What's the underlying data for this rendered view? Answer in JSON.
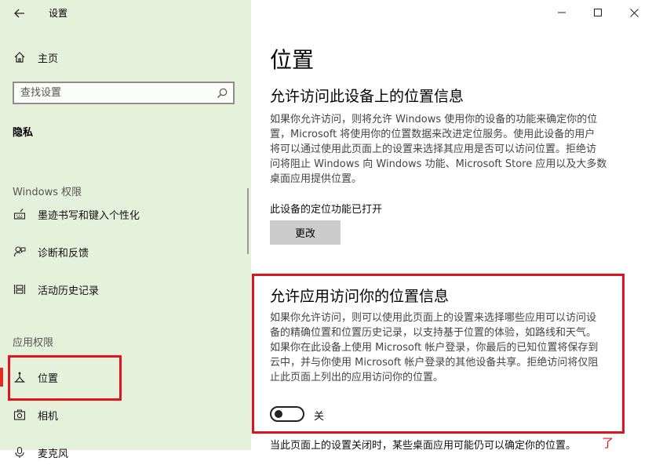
{
  "window": {
    "title": "设置",
    "controls": [
      "minimize",
      "maximize",
      "close"
    ]
  },
  "sidebar": {
    "home_label": "主页",
    "search_placeholder": "查找设置",
    "privacy_heading": "隐私",
    "windows_group": "Windows 权限",
    "windows_items": [
      {
        "label": "墨迹书写和键入个性化",
        "icon": "keyboard-pen-icon"
      },
      {
        "label": "诊断和反馈",
        "icon": "feedback-icon"
      },
      {
        "label": "活动历史记录",
        "icon": "activity-history-icon"
      }
    ],
    "app_group": "应用权限",
    "app_items": [
      {
        "label": "位置",
        "icon": "location-icon",
        "selected": true
      },
      {
        "label": "相机",
        "icon": "camera-icon"
      },
      {
        "label": "麦克风",
        "icon": "microphone-icon"
      }
    ]
  },
  "main": {
    "title": "位置",
    "section1": {
      "title": "允许访问此设备上的位置信息",
      "lines": [
        "如果你允许访问，则将允许 Windows 使用你的设备的功能来确定你的位",
        "置，Microsoft 将使用你的位置数据来改进定位服务。使用此设备的用户",
        "将可以通过使用此页面上的设置来选择其应用是否可以访问位置。拒绝访",
        "问将阻止 Windows 向 Windows 功能、Microsoft Store 应用以及大多数",
        "桌面应用提供位置。"
      ],
      "status": "此设备的定位功能已打开",
      "button": "更改"
    },
    "section2": {
      "title": "允许应用访问你的位置信息",
      "lines": [
        "如果你允许访问，则可以使用此页面上的设置来选择哪些应用可以访问设",
        "备的精确位置和位置历史记录，以支持基于位置的体验，如路线和天气。",
        "如果你在此设备上使用 Microsoft 帐户登录，你最后的已知位置将保存到",
        "云中，并与你使用 Microsoft 帐户登录的其他设备共享。拒绝访问将仅阻",
        "止此页面上列出的应用访问你的位置。"
      ],
      "toggle_state": "关",
      "toggle_on": false
    },
    "footer": "当此页面上的设置关闭时，某些桌面应用可能仍可以确定你的位置。",
    "footer_link": "了"
  },
  "colors": {
    "sidebar_bg": "#e6f1dc",
    "highlight_red": "#e0141e",
    "button_gray": "#cccccc"
  }
}
